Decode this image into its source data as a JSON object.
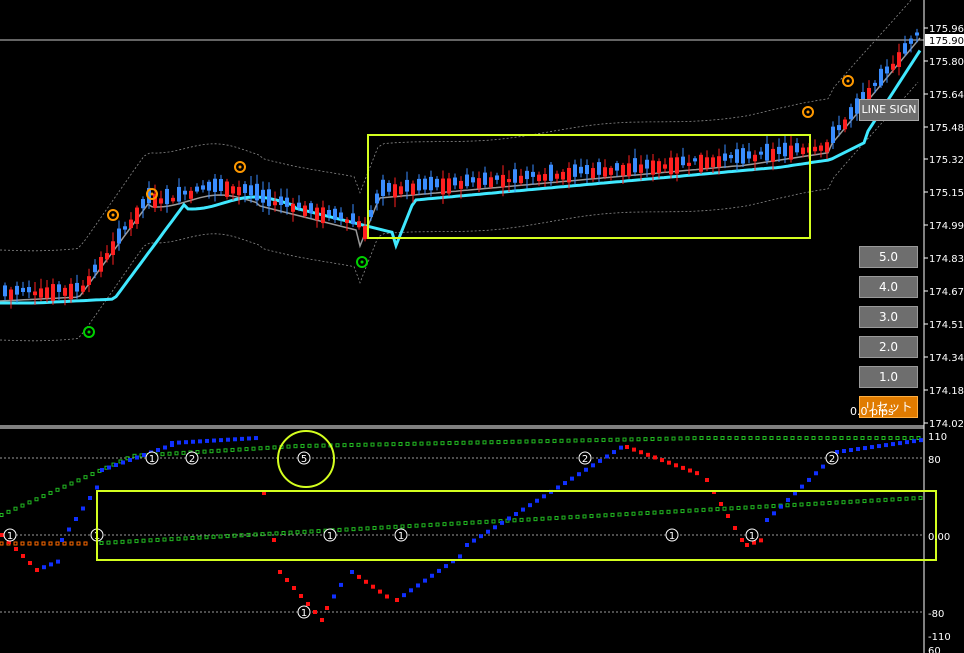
{
  "price_axis": {
    "ticks": [
      "175.965",
      "175.805",
      "175.640",
      "175.480",
      "175.320",
      "175.155",
      "174.995",
      "174.830",
      "174.670",
      "174.510",
      "174.345",
      "174.185",
      "174.020"
    ],
    "current_price": "175.904"
  },
  "osc_axis": {
    "ticks": [
      "110",
      "80",
      "0.00",
      "-80",
      "-110",
      "60"
    ],
    "zero_label": "0"
  },
  "buttons": {
    "line_sign": "LINE SIGN",
    "b50": "5.0",
    "b40": "4.0",
    "b30": "3.0",
    "b20": "2.0",
    "b10": "1.0",
    "reset": "リセット",
    "pips_label": "0.0 pips"
  },
  "markers": {
    "osc_numbers": [
      "1",
      "2",
      "5",
      "1",
      "2",
      "2",
      "1",
      "1",
      "1",
      "1",
      "1",
      "1"
    ]
  },
  "colors": {
    "background": "#000000",
    "bull": "#3a8dff",
    "bear": "#ff2020",
    "ma_fast": "#40e8ff",
    "ma_slow": "#9a9a9a",
    "highlight": "#d4ff1f",
    "signal_orange": "#ff9900",
    "signal_green": "#00d000",
    "osc_blue": "#1030ff",
    "osc_red": "#ff1010",
    "osc_green": "#22bb22",
    "osc_orange": "#ff6a00"
  }
}
